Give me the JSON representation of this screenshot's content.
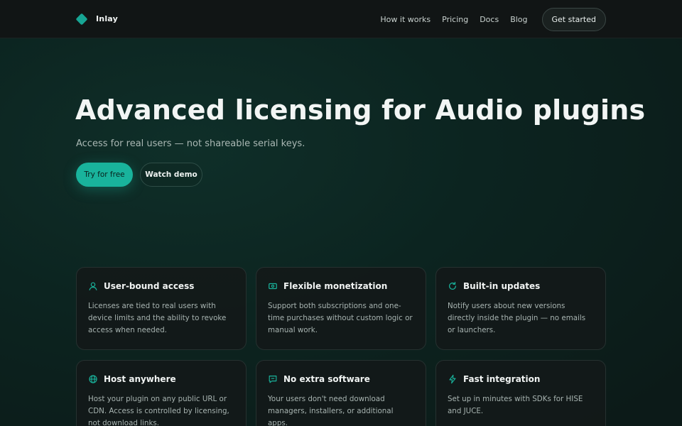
{
  "brand": {
    "name": "Inlay",
    "icon": "diamond-logo-icon",
    "color": "#17a594"
  },
  "nav": {
    "links": [
      "How it works",
      "Pricing",
      "Docs",
      "Blog"
    ],
    "cta": "Get started"
  },
  "hero": {
    "title": "Advanced licensing for Audio plugins",
    "subtitle": "Access for real users — not shareable serial keys.",
    "primary_button": "Try for free",
    "secondary_button": "Watch demo",
    "accent": "#19b39c"
  },
  "features": [
    {
      "icon": "user-icon",
      "title": "User-bound access",
      "text": "Licenses are tied to real users with device limits and the ability to revoke access when needed."
    },
    {
      "icon": "money-icon",
      "title": "Flexible monetization",
      "text": "Support both subscriptions and one-time purchases without custom logic or manual work."
    },
    {
      "icon": "refresh-icon",
      "title": "Built-in updates",
      "text": "Notify users about new versions directly inside the plugin — no emails or launchers."
    },
    {
      "icon": "globe-icon",
      "title": "Host anywhere",
      "text": "Host your plugin on any public URL or CDN. Access is controlled by licensing, not download links."
    },
    {
      "icon": "message-icon",
      "title": "No extra software",
      "text": "Your users don't need download managers, installers, or additional apps."
    },
    {
      "icon": "lightning-icon",
      "title": "Fast integration",
      "text": "Set up in minutes with SDKs for HISE and JUCE."
    }
  ]
}
